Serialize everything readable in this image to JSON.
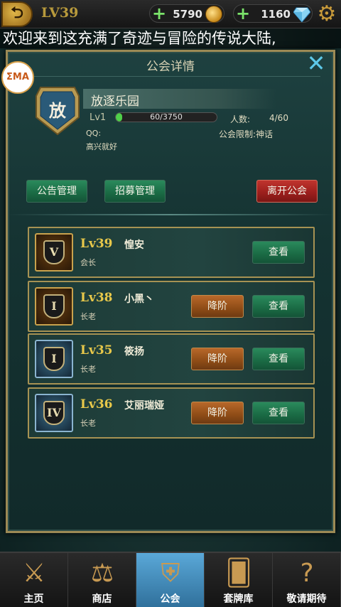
{
  "topbar": {
    "level": "LV39",
    "gold": "5790",
    "gems": "1160"
  },
  "marquee": "欢迎来到这充满了奇迹与冒险的传说大陆,",
  "watermark": "ƩMA",
  "panel": {
    "title": "公会详情",
    "guild": {
      "badge_char": "放",
      "name": "放逐乐园",
      "level": "Lv1",
      "exp_text": "60/3750",
      "exp_fraction": 0.016,
      "members_label": "人数:",
      "members_value": "4/60",
      "qq_label": "QQ:",
      "limit_label": "公会限制:神话",
      "motto": "高兴就好"
    },
    "buttons": {
      "announcement": "公告管理",
      "recruit": "招募管理",
      "leave": "离开公会"
    },
    "members": [
      {
        "lv": "Lv39",
        "name": "惶安",
        "role": "会长",
        "rank": "V",
        "frame": "gold",
        "demote": "",
        "view": "查看"
      },
      {
        "lv": "Lv38",
        "name": "小黑丶",
        "role": "长老",
        "rank": "I",
        "frame": "gold",
        "demote": "降阶",
        "view": "查看"
      },
      {
        "lv": "Lv35",
        "name": "筱扬",
        "role": "长老",
        "rank": "I",
        "frame": "blue",
        "demote": "降阶",
        "view": "查看"
      },
      {
        "lv": "Lv36",
        "name": "艾丽瑞娅",
        "role": "长老",
        "rank": "IV",
        "frame": "blue",
        "demote": "降阶",
        "view": "查看"
      }
    ]
  },
  "tabs": [
    {
      "label": "主页",
      "icon": "crossed-swords-icon",
      "active": false
    },
    {
      "label": "商店",
      "icon": "scales-icon",
      "active": false
    },
    {
      "label": "公会",
      "icon": "guild-emblem-icon",
      "active": true
    },
    {
      "label": "套牌库",
      "icon": "cards-icon",
      "active": false
    },
    {
      "label": "敬请期待",
      "icon": "question-mark-icon",
      "active": false
    }
  ],
  "colors": {
    "accent_gold": "#e8c84a",
    "button_green": "#1a6a44",
    "button_red": "#9a1e1c",
    "button_orange": "#8e4c16",
    "tab_active": "#5aa8d8"
  }
}
